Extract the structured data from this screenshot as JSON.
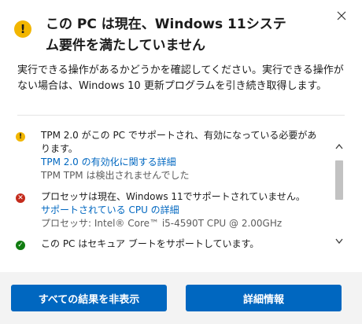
{
  "header": {
    "icon": "warning-icon",
    "title": "この PC は現在、Windows 11システム要件を満たしていません",
    "close_icon": "close-icon"
  },
  "description": "実行できる操作があるかどうかを確認してください。実行できる操作がない場合は、Windows 10 更新プログラムを引き続き取得します。",
  "checks": [
    {
      "status": "warning",
      "icon": "warning-icon",
      "text": "TPM 2.0 がこの PC でサポートされ、有効になっている必要があります。",
      "link": "TPM 2.0 の有効化に関する詳細",
      "detail": "TPM TPM は検出されませんでした"
    },
    {
      "status": "error",
      "icon": "error-icon",
      "text": "プロセッサは現在、Windows 11でサポートされていません。",
      "link": "サポートされている CPU の詳細",
      "detail": "プロセッサ: Intel® Core™ i5-4590T CPU @ 2.00GHz"
    },
    {
      "status": "ok",
      "icon": "check-icon",
      "text": "この PC はセキュア ブートをサポートしています。"
    }
  ],
  "scrollbar": {
    "up_icon": "chevron-up-icon",
    "down_icon": "chevron-down-icon"
  },
  "buttons": {
    "hide_all": "すべての結果を非表示",
    "details": "詳細情報"
  },
  "colors": {
    "accent": "#0067c0",
    "warning": "#f2b600",
    "error": "#c42b1c",
    "success": "#107c10",
    "footer_bg": "#f3f3f3"
  }
}
